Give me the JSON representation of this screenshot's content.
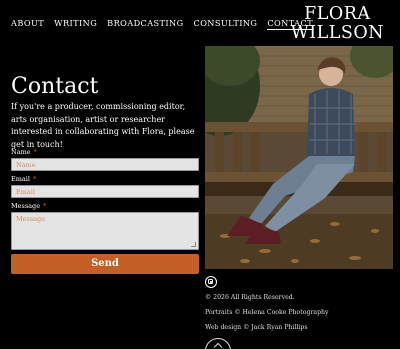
{
  "nav": {
    "about": "ABOUT",
    "writing": "WRITING",
    "broadcasting": "BROADCASTING",
    "consulting": "CONSULTING",
    "contact": "CONTACT"
  },
  "brand": {
    "line1": "FLORA",
    "line2": "WILLSON"
  },
  "page": {
    "title": "Contact",
    "intro": "If you're a producer, commissioning editor, arts organisation, artist or researcher interested in collaborating with Flora, please get in touch!"
  },
  "form": {
    "name_label": "Name",
    "name_placeholder": "Name",
    "email_label": "Email",
    "email_placeholder": "Email",
    "message_label": "Message",
    "message_placeholder": "Message",
    "required_mark": "*",
    "send_label": "Send"
  },
  "footer": {
    "instagram_icon": "instagram-icon",
    "copyright": "© 2026 All Rights Reserved.",
    "portraits": "Portraits © Helena Cooke Photography",
    "webdesign": "Web design © Jack Ryan Phillips",
    "scroll_top_icon": "chevron-up-icon"
  },
  "colors": {
    "background": "#000000",
    "accent": "#c45f28",
    "field_bg": "#e4e4e4",
    "placeholder": "#d58a65"
  }
}
